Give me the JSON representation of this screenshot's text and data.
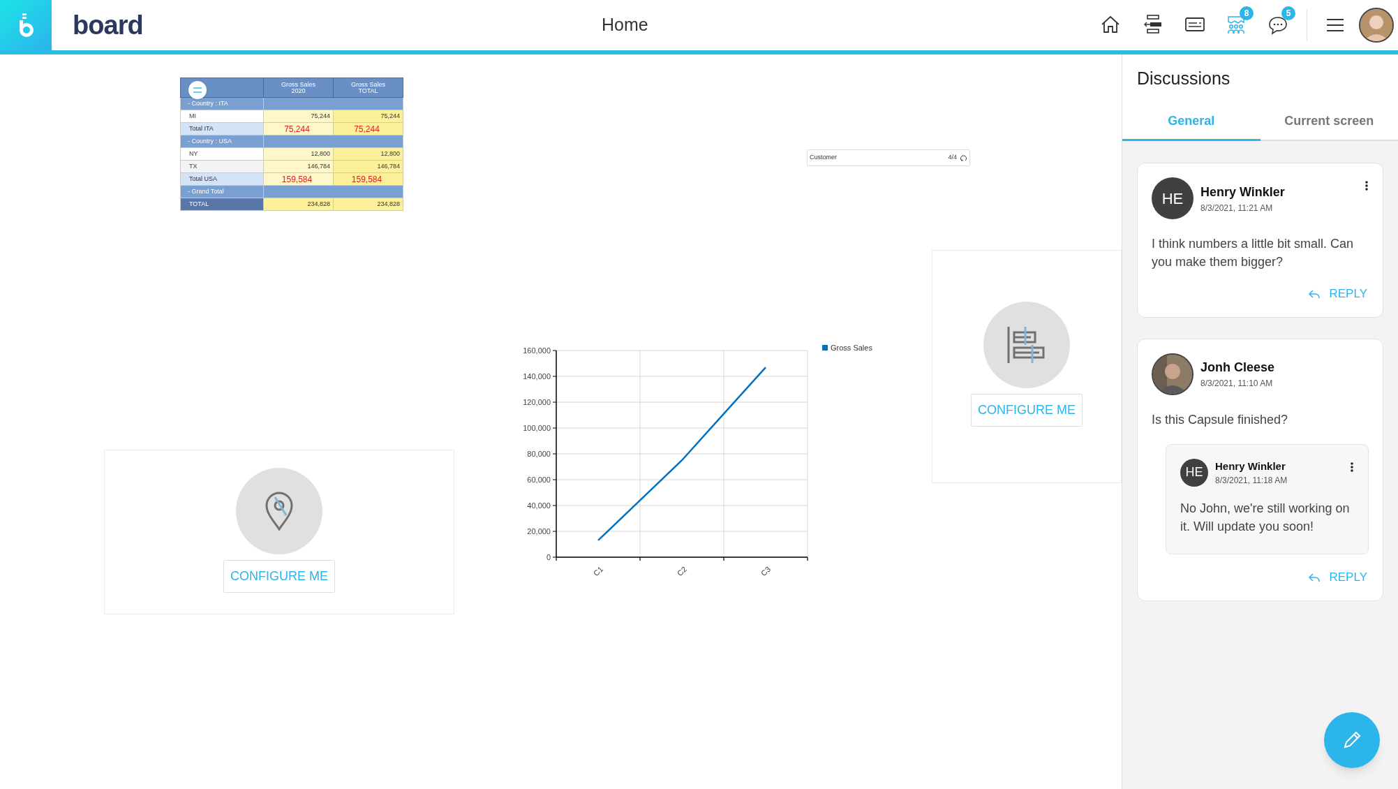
{
  "header": {
    "wordmark": "board",
    "title": "Home",
    "toolbar": [
      {
        "kind": "home",
        "selected": false
      },
      {
        "kind": "align",
        "selected": false
      },
      {
        "kind": "card",
        "selected": false
      },
      {
        "kind": "team",
        "selected": true,
        "badge": "8"
      },
      {
        "kind": "chat",
        "selected": false,
        "badge": "5"
      }
    ]
  },
  "canvas": {
    "table": {
      "columns": [
        {
          "title": "Gross Sales",
          "subtitle": "2020"
        },
        {
          "title": "Gross Sales",
          "subtitle": "TOTAL"
        }
      ],
      "rows": [
        {
          "kind": "group",
          "label": "-  Country : ITA"
        },
        {
          "kind": "item",
          "label": "MI",
          "values": [
            "75,244",
            "75,244"
          ]
        },
        {
          "kind": "subtotal",
          "label": "Total ITA",
          "values": [
            "75,244",
            "75,244"
          ]
        },
        {
          "kind": "group",
          "label": "-  Country : USA"
        },
        {
          "kind": "item",
          "label": "NY",
          "values": [
            "12,800",
            "12,800"
          ]
        },
        {
          "kind": "item_alt",
          "label": "TX",
          "values": [
            "146,784",
            "146,784"
          ]
        },
        {
          "kind": "subtotal",
          "label": "Total USA",
          "values": [
            "159,584",
            "159,584"
          ]
        },
        {
          "kind": "group",
          "label": "-  Grand Total"
        },
        {
          "kind": "total",
          "label": "TOTAL",
          "values": [
            "234,828",
            "234,828"
          ]
        }
      ]
    },
    "selector": {
      "label": "Customer",
      "count": "4/4"
    },
    "chart": {
      "chart_data": {
        "type": "line",
        "categories": [
          "C1",
          "C2",
          "C3"
        ],
        "series": [
          {
            "name": "Gross Sales",
            "color": "#0070c0",
            "values": [
              13000,
              75000,
              147000
            ]
          }
        ],
        "grid": true,
        "ylim": [
          0,
          160000
        ],
        "yticks": [
          {
            "value": 0,
            "label": "0"
          },
          {
            "value": 20000,
            "label": "20,000"
          },
          {
            "value": 40000,
            "label": "40,000"
          },
          {
            "value": 60000,
            "label": "60,000"
          },
          {
            "value": 80000,
            "label": "80,000"
          },
          {
            "value": 100000,
            "label": "100,000"
          },
          {
            "value": 120000,
            "label": "120,000"
          },
          {
            "value": 140000,
            "label": "140,000"
          },
          {
            "value": 160000,
            "label": "160,000"
          }
        ]
      }
    },
    "widgets": [
      {
        "kind": "gantt",
        "button": "CONFIGURE ME"
      },
      {
        "kind": "map",
        "button": "CONFIGURE ME"
      }
    ]
  },
  "discussions": {
    "title": "Discussions",
    "tabs": [
      {
        "label": "General",
        "selected": true
      },
      {
        "label": "Current screen",
        "selected": false
      }
    ],
    "threads": [
      {
        "author": "Henry Winkler",
        "avatar": {
          "kind": "initials",
          "initials": "HE"
        },
        "time": "8/3/2021, 11:21 AM",
        "text": "I think numbers a little bit small. Can you make them bigger?",
        "reply_label": "REPLY"
      },
      {
        "author": "Jonh Cleese",
        "avatar": {
          "kind": "photo"
        },
        "time": "8/3/2021, 11:10 AM",
        "text": "Is this Capsule finished?",
        "reply_label": "REPLY",
        "replies": [
          {
            "author": "Henry Winkler",
            "avatar": {
              "kind": "initials",
              "initials": "HE"
            },
            "time": "8/3/2021, 11:18 AM",
            "text": "No John, we're still working on it. Will update you soon!"
          }
        ]
      }
    ]
  }
}
